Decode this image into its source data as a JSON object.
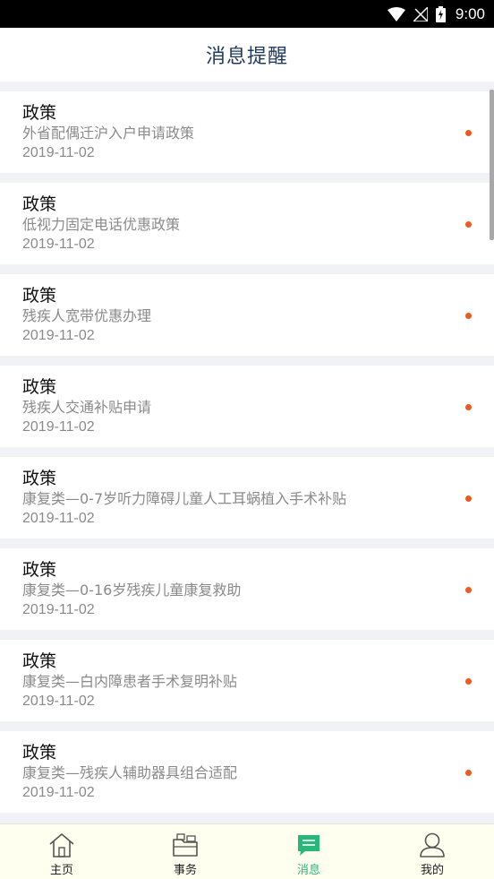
{
  "status_bar": {
    "time": "9:00"
  },
  "header": {
    "title": "消息提醒"
  },
  "messages": [
    {
      "type": "政策",
      "title": "外省配偶迁沪入户申请政策",
      "date": "2019-11-02"
    },
    {
      "type": "政策",
      "title": "低视力固定电话优惠政策",
      "date": "2019-11-02"
    },
    {
      "type": "政策",
      "title": "残疾人宽带优惠办理",
      "date": "2019-11-02"
    },
    {
      "type": "政策",
      "title": "残疾人交通补贴申请",
      "date": "2019-11-02"
    },
    {
      "type": "政策",
      "title": "康复类—0-7岁听力障碍儿童人工耳蜗植入手术补贴",
      "date": "2019-11-02"
    },
    {
      "type": "政策",
      "title": "康复类—0-16岁残疾儿童康复救助",
      "date": "2019-11-02"
    },
    {
      "type": "政策",
      "title": "康复类—白内障患者手术复明补贴",
      "date": "2019-11-02"
    },
    {
      "type": "政策",
      "title": "康复类—残疾人辅助器具组合适配",
      "date": "2019-11-02"
    }
  ],
  "tabbar": {
    "items": [
      {
        "label": "主页",
        "icon": "home-icon"
      },
      {
        "label": "事务",
        "icon": "folder-icon"
      },
      {
        "label": "消息",
        "icon": "message-icon",
        "active": true
      },
      {
        "label": "我的",
        "icon": "user-icon"
      }
    ]
  },
  "colors": {
    "accent": "#2ab77b",
    "unread_dot": "#ee5a1e",
    "title": "#1f3a5a"
  }
}
